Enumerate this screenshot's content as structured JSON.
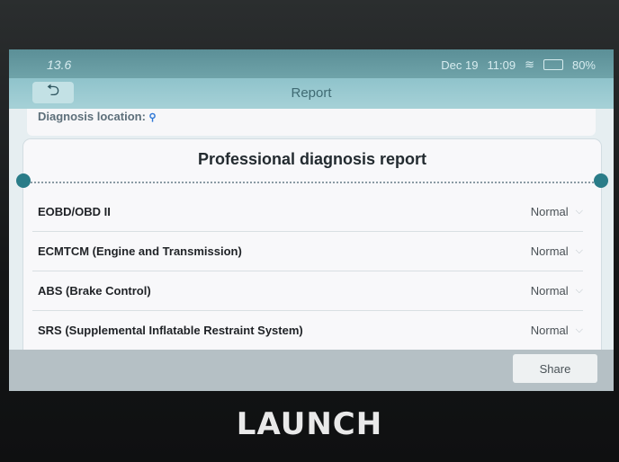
{
  "status": {
    "left_text": "13.6",
    "date": "Dec 19",
    "time": "11:09",
    "battery": "80%"
  },
  "appbar": {
    "back_icon": "back-arrow-icon",
    "title": "Report"
  },
  "location": {
    "label": "Diagnosis location:",
    "icon": "pin-icon"
  },
  "report": {
    "title": "Professional diagnosis report",
    "rows": [
      {
        "label": "EOBD/OBD II",
        "status": "Normal"
      },
      {
        "label": "ECMTCM (Engine and Transmission)",
        "status": "Normal"
      },
      {
        "label": "ABS (Brake Control)",
        "status": "Normal"
      },
      {
        "label": "SRS (Supplemental Inflatable Restraint System)",
        "status": "Normal"
      }
    ]
  },
  "actions": {
    "share_label": "Share"
  },
  "device": {
    "brand": "LAUNCH"
  },
  "colors": {
    "appbar": "#8fc3cb",
    "accent": "#2a7c88",
    "pin": "#2f78d6"
  }
}
